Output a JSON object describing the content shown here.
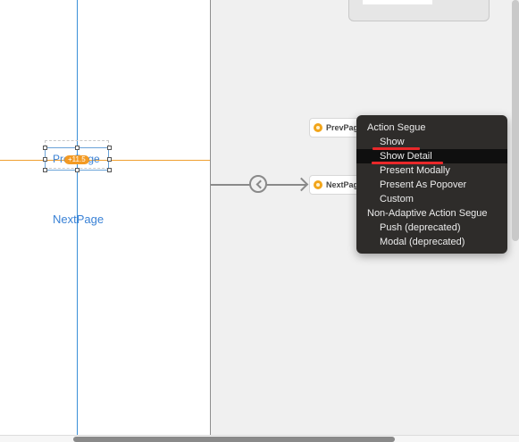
{
  "scene_left": {
    "prev_button_label": "PrevPage",
    "constraint_badge": "+11.5",
    "next_button_label": "NextPage"
  },
  "segue_targets": {
    "prev": "PrevPage",
    "next": "NextPage"
  },
  "segue_menu": {
    "action_header": "Action Segue",
    "action_items": [
      "Show",
      "Show Detail",
      "Present Modally",
      "Present As Popover",
      "Custom"
    ],
    "non_adaptive_header": "Non-Adaptive Action Segue",
    "non_adaptive_items": [
      "Push (deprecated)",
      "Modal (deprecated)"
    ],
    "highlighted_item": "Show Detail"
  },
  "colors": {
    "guide_vertical": "#3b8fd8",
    "guide_horizontal": "#f0a030",
    "badge": "#f39a23",
    "menu_background": "#2e2c2a",
    "annotation_underline": "#e8282a"
  },
  "icons": {
    "segue": "chevron-left-circle-icon",
    "view_controller": "view-controller-icon"
  }
}
